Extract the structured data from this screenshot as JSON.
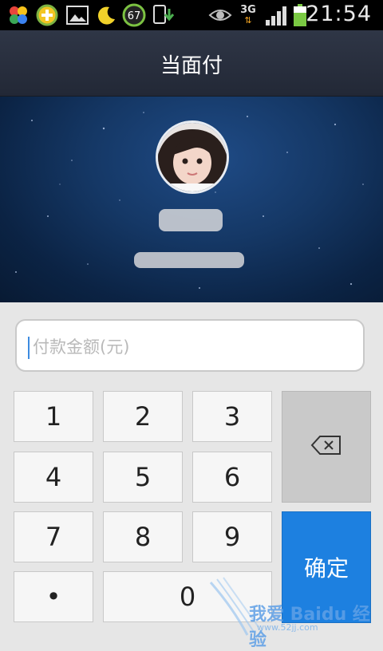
{
  "status_bar": {
    "icons": [
      "pinwheel-icon",
      "plus-badge-icon",
      "image-icon",
      "moon-icon",
      "battery-saver-icon",
      "download-icon",
      "eye-icon",
      "network-3g-icon",
      "signal-icon",
      "battery-icon"
    ],
    "badge_count": "67",
    "network": "3G",
    "time": "21:54"
  },
  "header": {
    "title": "当面付"
  },
  "payee": {
    "avatar": "avatar"
  },
  "amount": {
    "placeholder": "付款金额(元)",
    "value": ""
  },
  "keypad": {
    "keys": [
      "1",
      "2",
      "3",
      "4",
      "5",
      "6",
      "7",
      "8",
      "9",
      "•",
      "0"
    ],
    "delete_icon": "backspace-icon",
    "confirm_label": "确定"
  },
  "watermark": {
    "text": "我爱 Baidu 经验",
    "sub": "www.52jj.com"
  },
  "colors": {
    "accent": "#1d80e0",
    "title_bar": "#2a3040",
    "hero": "#153866",
    "battery": "#7ac943"
  }
}
